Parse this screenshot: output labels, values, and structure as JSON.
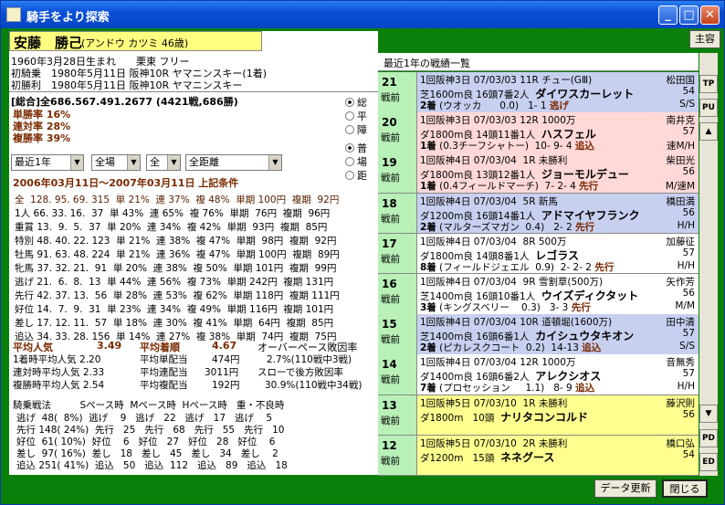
{
  "window": {
    "title": "騎手をより探索",
    "minimize": "_",
    "maximize": "□",
    "close": "✕",
    "corner_button": "主容"
  },
  "jockey": {
    "name": "安藤　勝己",
    "kana": "(アンドウ カツミ  46歳)",
    "birth": "1960年3月28日生まれ　　栗東 フリー",
    "first_ride": "初騎乗　1980年5月11日 阪神10R ヤマニンスキー(1着)",
    "first_win": "初勝利　1980年5月11日 阪神10R ヤマニンスキー"
  },
  "summary": {
    "total": "[総合]全686.567.491.2677 (4421戦,686勝)",
    "win_rate": "単勝率 16%",
    "place_rate": "連対率 28%",
    "show_rate": "複勝率 39%"
  },
  "radios1": [
    {
      "label": "総",
      "on": true
    },
    {
      "label": "平",
      "on": false
    },
    {
      "label": "障",
      "on": false
    }
  ],
  "radios2": [
    {
      "label": "普",
      "on": true
    },
    {
      "label": "場",
      "on": false
    },
    {
      "label": "距",
      "on": false
    }
  ],
  "filters": {
    "period": "最近1年",
    "place": "全場",
    "class": "全",
    "distance": "全距離"
  },
  "condition": "2006年03月11日～2007年03月11日 上記条件",
  "stats_rows": [
    "全  128. 95. 69. 315  単 21%  連 37%  複 48%  単期 100円  複期  92円",
    "1人 66. 33. 16.  37  単 43%  連 65%  複 76%  単期  76円  複期  96円",
    "重賞 13.  9.  5.  37  単 20%  連 34%  複 42%  単期  93円  複期  85円",
    "特別 48. 40. 22. 123  単 21%  連 38%  複 47%  単期  98円  複期  92円",
    "牡馬 91. 63. 48. 224  単 21%  連 36%  複 47%  単期 100円  複期  89円",
    "牝馬 37. 32. 21.  91  単 20%  連 38%  複 50%  単期 101円  複期  99円",
    "逃げ 21.  6.  8.  13  単 44%  連 56%  複 73%  単期 242円  複期 131円",
    "先行 42. 37. 13.  56  単 28%  連 53%  複 62%  単期 118円  複期 111円",
    "好位 14.  7.  9.  31  単 23%  連 34%  複 49%  単期 116円  複期 101円",
    "差し 17. 12. 11.  57  単 18%  連 30%  複 41%  単期  64円  複期  85円",
    "追込 34. 33. 28. 156  単 14%  連 27%  複 38%  単期  74円  複期  75円"
  ],
  "averages": {
    "pop_label": "平均人気",
    "pop_val": "3.49",
    "finish_label": "平均着順",
    "finish_val": "4.67",
    "overpace": "オーバーペース敗因率",
    "win_pop": "1着時平均人気 2.20",
    "win_pay_label": "平均単配当",
    "win_pay": "474円",
    "overpace_val": "2.7%(110戦中3戦)",
    "place_pop": "連対時平均人気 2.33",
    "place_pay_label": "平均連配当",
    "place_pay": "3011円",
    "slow": "スローで後方敗因率",
    "show_pop": "複勝時平均人気 2.54",
    "show_pay_label": "平均複配当",
    "show_pay": "192円",
    "slow_val": "30.9%(110戦中34戦)"
  },
  "tactics": {
    "header": "騎乗戦法　　　Sペース時  Mペース時  Hペース時   重・不良時",
    "rows": [
      "逃げ  48(  8%)  逃げ    9   逃げ   22   逃げ   17   逃げ    5",
      "先行 148( 24%)  先行   25   先行   68   先行   55   先行   10",
      "好位  61( 10%)  好位    6   好位   27   好位   28   好位    6",
      "差し  97( 16%)  差し   18   差し   45   差し   34   差し    2",
      "追込 251( 41%)  追込   50   追込  112   追込   89   追込   18"
    ]
  },
  "right": {
    "title": "最近1年の戦績一覧"
  },
  "races": [
    {
      "rank": "21",
      "ago": "戦前",
      "l1": "1回阪神3日 07/03/03 11R チュー(GⅢ)",
      "jockey": "松田国",
      "l2a": "芝1600m良 16頭7番2人",
      "horse": "ダイワスカーレット",
      "wt": "54",
      "finish": "2着",
      "l3": "(ウオッカ      0.0)   1- 1",
      "style": "逃げ",
      "pace": "S/S",
      "bg": "#c8d0f0"
    },
    {
      "rank": "20",
      "ago": "戦前",
      "l1": "1回阪神3日 07/03/03 12R 1000万",
      "jockey": "南井克",
      "l2a": "ダ1800m良 14頭11番1人",
      "horse": "ハスフェル",
      "wt": "57",
      "finish": "1着",
      "l3": "(0.3チーフシャトー)  10- 9- 4",
      "style": "追込",
      "pace": "速M/H",
      "bg": "#ffd8d8"
    },
    {
      "rank": "19",
      "ago": "戦前",
      "l1": "1回阪神4日 07/03/04  1R 未勝利",
      "jockey": "柴田光",
      "l2a": "ダ1800m良 13頭12番1人",
      "horse": "ジョーモルデュー",
      "wt": "56",
      "finish": "1着",
      "l3": "(0.4フィールドマーチ)  7- 2- 4",
      "style": "先行",
      "pace": "M/速M",
      "bg": "#ffd8d8"
    },
    {
      "rank": "18",
      "ago": "戦前",
      "l1": "1回阪神4日 07/03/04  5R 新馬",
      "jockey": "橋田満",
      "l2a": "ダ1200m良 16頭14番1人",
      "horse": "アドマイヤフランク",
      "wt": "56",
      "finish": "2着",
      "l3": "(マルターズマガン  0.4)   2- 2",
      "style": "先行",
      "pace": "H/H",
      "bg": "#c8d0f0"
    },
    {
      "rank": "17",
      "ago": "戦前",
      "l1": "1回阪神4日 07/03/04  8R 500万",
      "jockey": "加藤征",
      "l2a": "ダ1800m良 14頭8番1人",
      "horse": "レゴラス",
      "wt": "57",
      "finish": "8着",
      "l3": "(フィールドジェエル  0.9)  2- 2- 2",
      "style": "先行",
      "pace": "H/H",
      "bg": "#ffffff"
    },
    {
      "rank": "16",
      "ago": "戦前",
      "l1": "1回阪神4日 07/03/04  9R 雪割草(500万)",
      "jockey": "矢作芳",
      "l2a": "芝1400m良 16頭10番1人",
      "horse": "ウイズディクタット",
      "wt": "56",
      "finish": "3着",
      "l3": "(キングスベリー    0.3)   3- 3",
      "style": "先行",
      "pace": "M/M",
      "bg": "#ffffff"
    },
    {
      "rank": "15",
      "ago": "戦前",
      "l1": "1回阪神4日 07/03/04 10R 道頓堀(1600万)",
      "jockey": "田中清",
      "l2a": "芝1400m良 16頭6番1人",
      "horse": "カイシュウタキオン",
      "wt": "57",
      "finish": "2着",
      "l3": "(ピカレスクコート  0.2)  14-13",
      "style": "追込",
      "pace": "S/S",
      "bg": "#c8d0f0"
    },
    {
      "rank": "14",
      "ago": "戦前",
      "l1": "1回阪神4日 07/03/04 12R 1000万",
      "jockey": "音無秀",
      "l2a": "ダ1400m良 16頭6番2人",
      "horse": "アレクシオス",
      "wt": "57",
      "finish": "7着",
      "l3": "(プロセッション     1.1)   8- 9",
      "style": "追込",
      "pace": "H/H",
      "bg": "#ffffff"
    },
    {
      "rank": "13",
      "ago": "戦前",
      "l1": "1回阪神5日 07/03/10  1R 未勝利",
      "jockey": "藤沢則",
      "l2a": "ダ1800m   10頭",
      "horse": "ナリタコンコルド",
      "wt": "56",
      "finish": "",
      "l3": "",
      "style": "",
      "pace": "",
      "bg": "#ffff90"
    },
    {
      "rank": "12",
      "ago": "戦前",
      "l1": "1回阪神5日 07/03/10  2R 未勝利",
      "jockey": "橋口弘",
      "l2a": "ダ1200m   15頭",
      "horse": "ネネグース",
      "wt": "54",
      "finish": "",
      "l3": "",
      "style": "",
      "pace": "",
      "bg": "#ffff90"
    }
  ],
  "sidebar": {
    "tp": "TP",
    "pu": "PU",
    "up": "▲",
    "down": "▼",
    "pd": "PD",
    "ed": "ED"
  },
  "buttons": {
    "update": "データ更新",
    "close": "閉じる"
  }
}
